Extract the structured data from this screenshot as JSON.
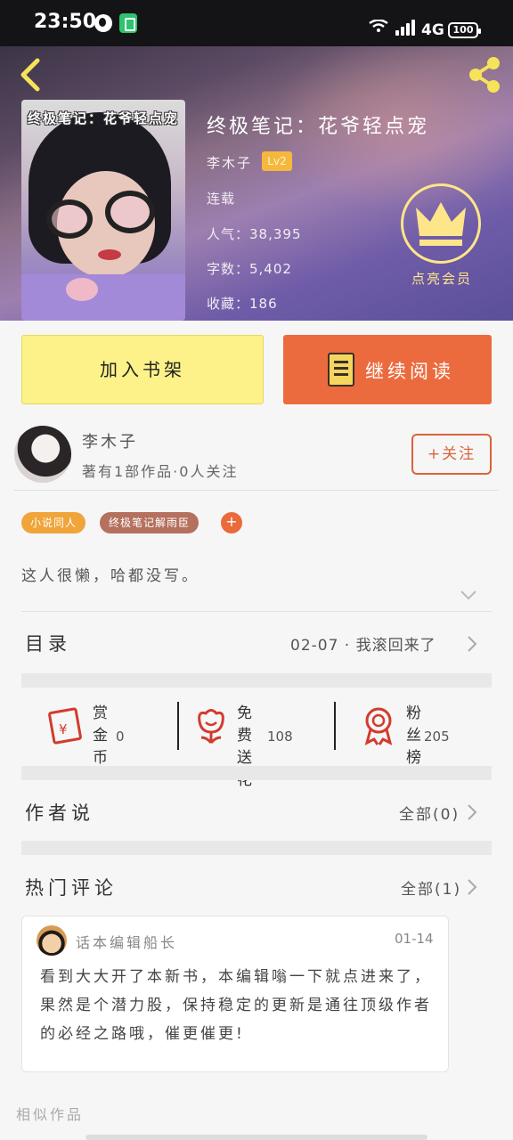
{
  "status_bar": {
    "time": "23:50",
    "network": "4G",
    "battery": "100"
  },
  "header": {
    "cover_title": "终极笔记：花爷轻点宠",
    "book_title": "终极笔记：花爷轻点宠",
    "author": "李木子",
    "level": "Lv2",
    "status": "连载",
    "popularity": "人气：38,395",
    "word_count": "字数：5,402",
    "favorites": "收藏：186",
    "vip_label": "点亮会员"
  },
  "actions": {
    "add_shelf": "加入书架",
    "continue_read": "继续阅读"
  },
  "author_card": {
    "name": "李木子",
    "stats": "著有1部作品·0人关注",
    "follow": "+关注",
    "tags": [
      "小说同人",
      "终极笔记解雨臣"
    ],
    "tag_add": "+",
    "bio": "这人很懒，哈都没写。"
  },
  "toc": {
    "label": "目录",
    "latest": "02-07 · 我滚回来了"
  },
  "stats": [
    {
      "title": "赏金币",
      "value": "0"
    },
    {
      "title": "免费送花",
      "value": "108"
    },
    {
      "title": "粉丝榜",
      "value": "205"
    }
  ],
  "author_says": {
    "title": "作者说",
    "more": "全部(0)"
  },
  "hot_comments": {
    "title": "热门评论",
    "more": "全部(1)",
    "items": [
      {
        "name": "话本编辑船长",
        "date": "01-14",
        "body": "看到大大开了本新书，本编辑嗡一下就点进来了，果然是个潜力股，保持稳定的更新是通往顶级作者的必经之路哦，催更催更!"
      }
    ]
  },
  "similar": "相似作品",
  "colors": {
    "accent": "#ec6b3e",
    "shelf_btn": "#fcf289",
    "vip": "#ffe58a"
  }
}
